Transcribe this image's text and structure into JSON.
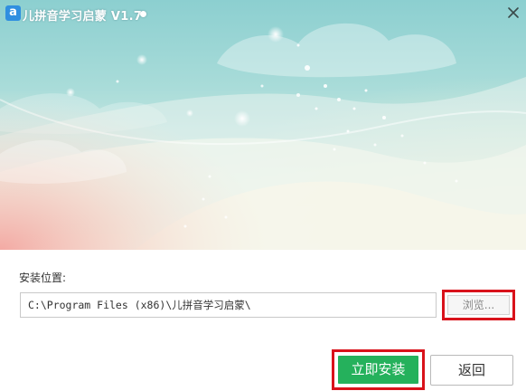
{
  "window": {
    "title": "儿拼音学习启蒙 V1.7",
    "app_icon_glyph": "a",
    "close_glyph": "×"
  },
  "install": {
    "path_label": "安装位置:",
    "path_value": "C:\\Program Files (x86)\\儿拼音学习启蒙\\",
    "browse_label": "浏览...",
    "install_label": "立即安装",
    "back_label": "返回"
  },
  "colors": {
    "accent_green": "#25b15c",
    "highlight_red": "#d9121b",
    "app_icon_blue": "#2f8fe0"
  }
}
